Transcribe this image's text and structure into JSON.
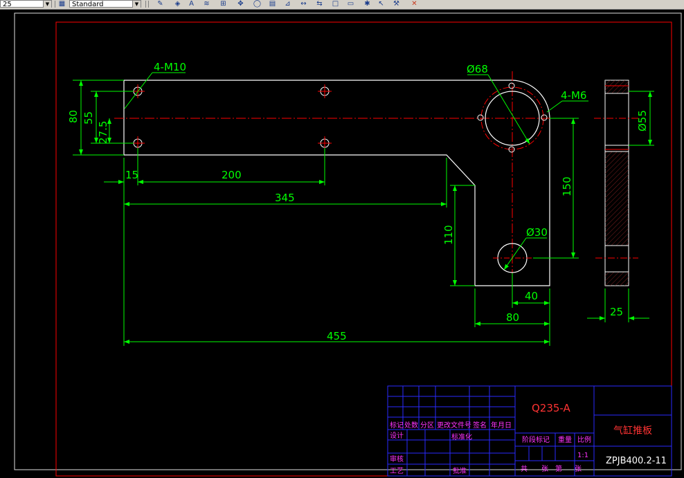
{
  "toolbar": {
    "layer_value": "25",
    "style_value": "Standard",
    "icons": [
      "pencil-icon",
      "match-props-icon",
      "text-style-icon",
      "dim-style-icon",
      "grid-icon",
      "pan-icon",
      "orbit-icon",
      "table-icon",
      "measure-icon",
      "dimension-icon",
      "rect-icon",
      "rect2-icon",
      "snap-icon",
      "pointer-icon",
      "tool-icon"
    ]
  },
  "drawing": {
    "dims": {
      "hole_m10": "4-M10",
      "height_80": "80",
      "height_55": "55",
      "height_27_5": "27.5",
      "width_15": "15",
      "width_200": "200",
      "width_345": "345",
      "width_455": "455",
      "dia_68": "Ø68",
      "hole_m6": "4-M6",
      "height_150": "150",
      "height_110": "110",
      "dia_30": "Ø30",
      "width_40": "40",
      "width_80": "80",
      "side_dia_55": "Ø55",
      "side_25": "25"
    },
    "title_block": {
      "material": "Q235-A",
      "part_name": "气缸推板",
      "drawing_no": "ZPJB400.2-11",
      "scale": "1:1",
      "labels": {
        "mark": "标记",
        "count": "处数",
        "zone": "分区",
        "change_doc": "更改文件号",
        "signature": "签名",
        "date": "年月日",
        "design": "设计",
        "standardize": "标准化",
        "review": "审核",
        "process": "工艺",
        "approve": "批准",
        "stage_mark": "阶段标记",
        "weight": "重量",
        "scale_label": "比例",
        "total": "共",
        "sheet1": "张",
        "page": "第",
        "sheet2": "张"
      }
    }
  }
}
